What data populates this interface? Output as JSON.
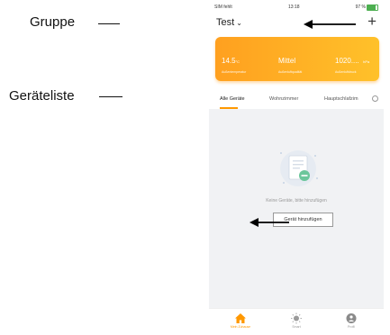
{
  "annotations": {
    "group_label": "Gruppe",
    "device_list_label": "Geräteliste"
  },
  "status_bar": {
    "carrier": "SIM fehlt",
    "time": "13:18",
    "battery": "97 %"
  },
  "header": {
    "group_name": "Test",
    "add_label": "+"
  },
  "weather_card": {
    "metrics": [
      {
        "value": "14.5",
        "unit": "°C",
        "label": "Außentemperatur"
      },
      {
        "value": "Mittel",
        "unit": "",
        "label": "Außenluftqualität"
      },
      {
        "value": "1020....",
        "unit": "hPa",
        "label": "Außenluftdruck"
      }
    ]
  },
  "tabs": [
    "Alle Geräte",
    "Wohnzimmer",
    "Hauptschlafzim"
  ],
  "device_list": {
    "empty_text": "Keine Geräte, bitte hinzufügen",
    "add_button": "Gerät hinzufügen"
  },
  "bottom_nav": [
    {
      "label": "Mein Zuhause",
      "icon": "home-icon"
    },
    {
      "label": "Smart",
      "icon": "sun-icon"
    },
    {
      "label": "Profil",
      "icon": "profile-icon"
    }
  ],
  "colors": {
    "accent": "#ff9800",
    "card_gradient_start": "#ffa01f",
    "card_gradient_end": "#ffc12a",
    "list_background": "#f1f2f4"
  }
}
